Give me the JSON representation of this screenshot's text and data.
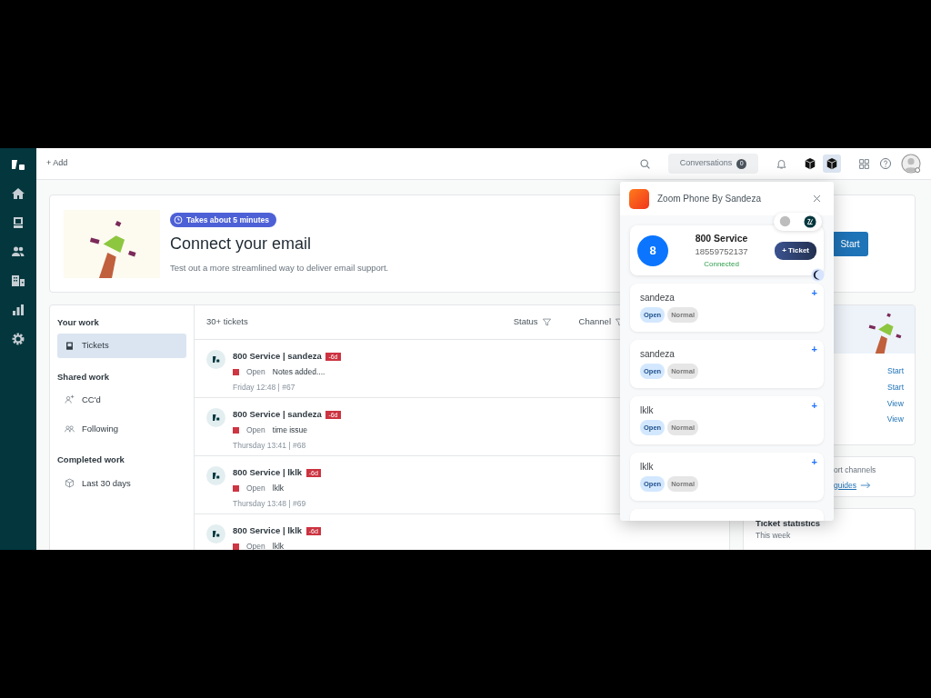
{
  "topbar": {
    "add": "+ Add",
    "conversations": {
      "label": "Conversations",
      "count": "0"
    },
    "apps": [
      {
        "selected": false
      },
      {
        "selected": true
      }
    ]
  },
  "hero": {
    "badge": "Takes about 5 minutes",
    "title": "Connect your email",
    "text": "Test out a more streamlined way to deliver email support.",
    "button": "Start"
  },
  "work_nav": [
    {
      "heading": "Your work",
      "items": [
        {
          "kind": "tickets",
          "label": "Tickets",
          "selected": true
        }
      ]
    },
    {
      "heading": "Shared work",
      "items": [
        {
          "kind": "ccd",
          "label": "CC'd",
          "selected": false
        },
        {
          "kind": "following",
          "label": "Following",
          "selected": false
        }
      ]
    },
    {
      "heading": "Completed work",
      "items": [
        {
          "kind": "archive",
          "label": "Last 30 days",
          "selected": false
        }
      ]
    }
  ],
  "tickets": {
    "count": "30+ tickets",
    "columns": [
      "Status",
      "Channel"
    ],
    "rows": [
      {
        "subject": "800 Service | sandeza",
        "age": "-6d",
        "color": "#cd3642",
        "status": "Open",
        "preview": "Notes added....",
        "meta": "Friday 12:48 | #67"
      },
      {
        "subject": "800 Service | sandeza",
        "age": "-6d",
        "color": "#cd3642",
        "status": "Open",
        "preview": "time issue",
        "meta": "Thursday 13:41 | #68"
      },
      {
        "subject": "800 Service | lklk",
        "age": "-6d",
        "color": "#cd3642",
        "status": "Open",
        "preview": "lklk",
        "meta": "Thursday 13:48 | #69"
      },
      {
        "subject": "800 Service | lklk",
        "age": "-6d",
        "color": "#cd3642",
        "status": "Open",
        "preview": "lklk"
      }
    ]
  },
  "right_panel": {
    "links": [
      "Start",
      "Start",
      "View",
      "View"
    ],
    "channels_text": "ort channels",
    "guides_link": "guides",
    "stats": {
      "title": "Ticket statistics",
      "subtitle": "This week"
    }
  },
  "popup": {
    "title": "Zoom Phone By Sandeza",
    "call": {
      "avatar": "8",
      "name": "800 Service",
      "number": "18559752137",
      "state": "Connected",
      "ticket_button": "+ Ticket"
    },
    "tickets": [
      {
        "name": "sandeza",
        "status": "Open",
        "priority": "Normal",
        "action": "+"
      },
      {
        "name": "sandeza",
        "status": "Open",
        "priority": "Normal",
        "action": "+"
      },
      {
        "name": "lklk",
        "status": "Open",
        "priority": "Normal",
        "action": "+"
      },
      {
        "name": "lklk",
        "status": "Open",
        "priority": "Normal",
        "action": "+"
      }
    ]
  }
}
